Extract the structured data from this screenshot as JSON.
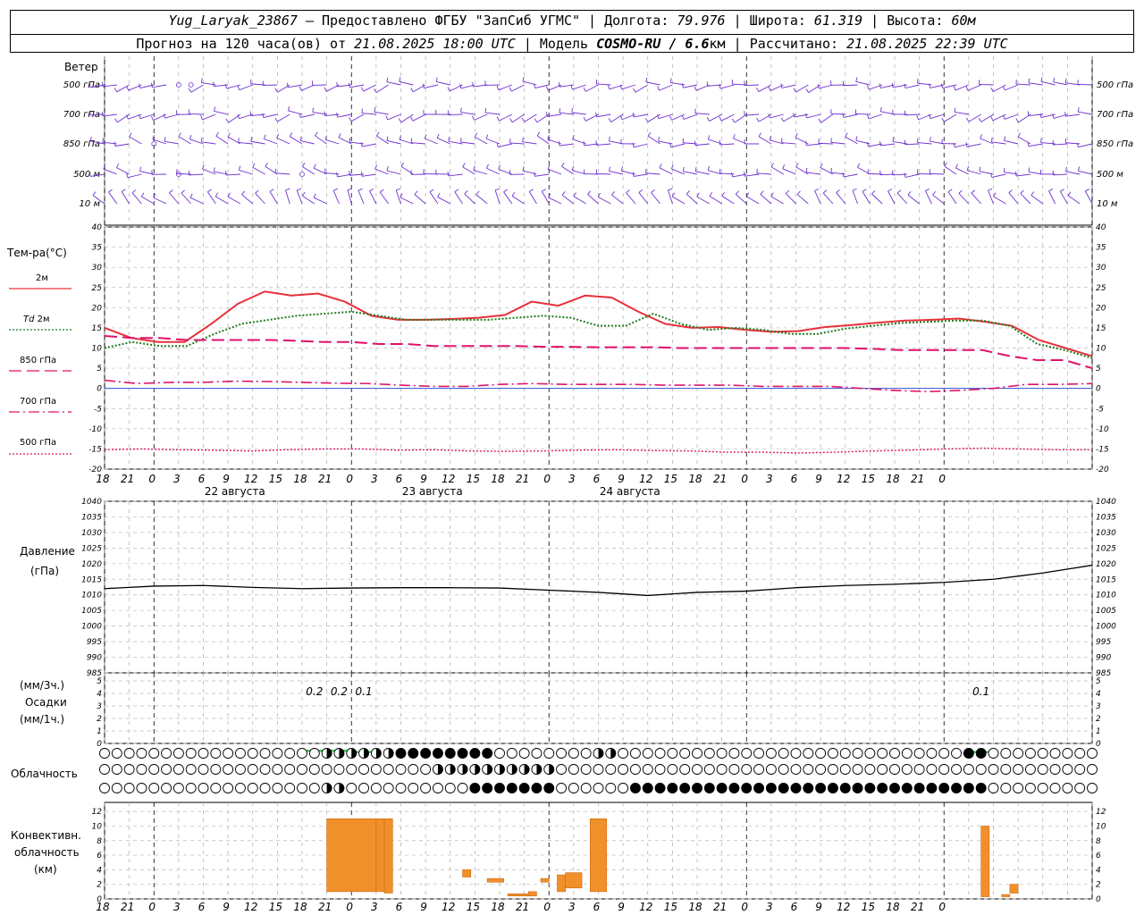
{
  "header": {
    "station": "Yug_Laryak_23867",
    "provider": "Предоставлено ФГБУ \"ЗапСиб УГМС\"",
    "lon_label": "Долгота:",
    "lon": "79.976",
    "lat_label": "Широта:",
    "lat": "61.319",
    "alt_label": "Высота:",
    "alt": "60м",
    "forecast_label": "Прогноз на 120 часа(ов) от",
    "forecast_start": "21.08.2025 18:00 UTC",
    "model_label": "Модель",
    "model": "COSMO-RU / 6.6",
    "model_unit": "км",
    "calc_label": "Рассчитано:",
    "calc_time": "21.08.2025 22:39 UTC"
  },
  "wind": {
    "title": "Ветер",
    "levels": [
      "500 гПа",
      "700 гПа",
      "850 гПа",
      "500 м",
      "10 м"
    ]
  },
  "temperature": {
    "title": "Тем-ра(°С)",
    "legend": [
      {
        "label": "2м",
        "color": "#e8303a",
        "style": "solid"
      },
      {
        "label": "Td 2м",
        "color": "#1f7a1f",
        "style": "dotted"
      },
      {
        "label": "850 гПа",
        "color": "#e0106a",
        "style": "dashed"
      },
      {
        "label": "700 гПа",
        "color": "#e0106a",
        "style": "dashdot"
      },
      {
        "label": "500 гПа",
        "color": "#e0106a",
        "style": "dotted"
      }
    ]
  },
  "time_axis": {
    "hours": [
      "18",
      "21",
      "0",
      "3",
      "6",
      "9",
      "12",
      "15",
      "18",
      "21",
      "0",
      "3",
      "6",
      "9",
      "12",
      "15",
      "18",
      "21",
      "0",
      "3",
      "6",
      "9",
      "12",
      "15",
      "18",
      "21",
      "0",
      "3",
      "6",
      "9",
      "12",
      "15",
      "18",
      "21",
      "0"
    ],
    "days": [
      "22 августа",
      "23 августа",
      "24 августа"
    ]
  },
  "pressure": {
    "title_line1": "Давление",
    "title_line2": "(гПа)"
  },
  "precip": {
    "line1": "(мм/3ч.)",
    "line2": "Осадки",
    "line3": "(мм/1ч.)",
    "labels": [
      "0.2",
      "0.2",
      "0.1",
      "0.1"
    ]
  },
  "clouds": {
    "title": "Облачность"
  },
  "convective": {
    "line1": "Конвективн.",
    "line2": "облачность",
    "line3": "(км)"
  },
  "chart_data": [
    {
      "type": "line",
      "title": "Тем-ра(°С)",
      "x_hours": [
        0,
        3,
        6,
        9,
        12,
        15,
        18,
        21,
        24,
        27,
        30,
        33,
        36,
        39,
        42,
        45,
        48,
        51,
        54,
        57,
        60,
        63,
        66,
        69,
        72,
        75,
        78,
        81,
        84,
        87,
        90,
        93,
        96,
        99,
        102,
        105,
        108,
        111,
        114,
        117,
        120
      ],
      "ylim": [
        -20,
        40
      ],
      "series": [
        {
          "name": "2м",
          "values": [
            15,
            12.5,
            11.5,
            11.5,
            16,
            21,
            24,
            23,
            23.5,
            21.5,
            18,
            17,
            17,
            17.2,
            17.5,
            18.2,
            21.5,
            20.5,
            23,
            22.5,
            19,
            16,
            15,
            15.2,
            14.5,
            14,
            14.2,
            15.2,
            15.7,
            16.3,
            16.8,
            17,
            17.3,
            16.5,
            15.5,
            12,
            10,
            8
          ]
        },
        {
          "name": "Td 2м",
          "values": [
            10,
            11.5,
            10.5,
            10.5,
            13.5,
            16,
            17,
            18,
            18.5,
            19,
            18,
            17,
            17,
            17,
            17,
            17.5,
            18,
            17.5,
            15.5,
            15.5,
            18.5,
            16,
            14.5,
            15,
            14.5,
            13.5,
            13.5,
            14.8,
            15.5,
            16.2,
            16.5,
            16.8,
            16.8,
            15.5,
            11,
            9.5,
            7.5
          ]
        },
        {
          "name": "850 гПа",
          "values": [
            13,
            12.5,
            12.5,
            12,
            12,
            12,
            12,
            11.8,
            11.5,
            11.5,
            11,
            11,
            10.5,
            10.5,
            10.5,
            10.5,
            10.3,
            10.3,
            10.2,
            10.2,
            10.2,
            10,
            10,
            10,
            10,
            10,
            10,
            10,
            9.8,
            9.5,
            9.5,
            9.5,
            9.5,
            8,
            7,
            7,
            5
          ]
        },
        {
          "name": "700 гПа",
          "values": [
            2,
            1.2,
            1.5,
            1.5,
            1.8,
            1.7,
            1.5,
            1.3,
            1.2,
            0.8,
            0.5,
            0.5,
            1,
            1.2,
            1,
            1,
            1,
            0.8,
            0.8,
            0.8,
            0.5,
            0.5,
            0.5,
            0,
            -0.5,
            -0.8,
            -0.5,
            0,
            1,
            1,
            1.2
          ]
        },
        {
          "name": "500 гПа",
          "values": [
            -15.2,
            -15,
            -15.2,
            -15.3,
            -15.5,
            -15.2,
            -15,
            -15,
            -15.3,
            -15.2,
            -15.5,
            -15.6,
            -15.5,
            -15.3,
            -15.2,
            -15.4,
            -15.5,
            -15.8,
            -15.8,
            -16,
            -15.8,
            -15.5,
            -15.3,
            -15,
            -14.8,
            -15,
            -15.2,
            -15.2
          ]
        }
      ]
    },
    {
      "type": "line",
      "title": "Давление (гПа)",
      "x_hours": [
        0,
        6,
        12,
        18,
        24,
        30,
        36,
        42,
        48,
        54,
        60,
        66,
        72,
        78,
        84,
        90,
        96,
        102,
        108,
        114,
        120
      ],
      "ylim": [
        985,
        1040
      ],
      "series": [
        {
          "name": "",
          "values": [
            1012,
            1012.8,
            1013,
            1012.4,
            1012,
            1012.2,
            1012.3,
            1012.3,
            1012.2,
            1011.5,
            1010.8,
            1009.8,
            1010.8,
            1011.2,
            1012.3,
            1013,
            1013.4,
            1014,
            1015,
            1017,
            1019.5
          ]
        }
      ]
    },
    {
      "type": "bar",
      "title": "Осадки (мм/3ч.)",
      "x_hours": [
        27,
        30,
        33,
        108
      ],
      "ylim": [
        0,
        5
      ],
      "values": [
        0.2,
        0.2,
        0.1,
        0.1
      ],
      "labels": [
        "0.2",
        "0.2",
        "0.1",
        "0.1"
      ]
    },
    {
      "type": "bar",
      "title": "Конвективн. облачность (км)",
      "ylim": [
        0,
        13
      ],
      "bars": [
        {
          "from_hour": 27,
          "to_hour": 33,
          "bottom": 1,
          "top": 11
        },
        {
          "from_hour": 33,
          "to_hour": 34,
          "bottom": 1,
          "top": 11
        },
        {
          "from_hour": 34,
          "to_hour": 35,
          "bottom": 0.8,
          "top": 11
        },
        {
          "from_hour": 43.5,
          "to_hour": 44.5,
          "bottom": 3,
          "top": 4
        },
        {
          "from_hour": 46.5,
          "to_hour": 48.5,
          "bottom": 2.3,
          "top": 2.8
        },
        {
          "from_hour": 49,
          "to_hour": 51.5,
          "bottom": 0.4,
          "top": 0.7
        },
        {
          "from_hour": 51.5,
          "to_hour": 52.5,
          "bottom": 0.4,
          "top": 1
        },
        {
          "from_hour": 53,
          "to_hour": 54,
          "bottom": 2.3,
          "top": 2.8
        },
        {
          "from_hour": 55,
          "to_hour": 56,
          "bottom": 1,
          "top": 3.3
        },
        {
          "from_hour": 56,
          "to_hour": 58,
          "bottom": 1.5,
          "top": 3.6
        },
        {
          "from_hour": 59,
          "to_hour": 61,
          "bottom": 1,
          "top": 11
        },
        {
          "from_hour": 106.5,
          "to_hour": 107.5,
          "bottom": 0.3,
          "top": 10
        },
        {
          "from_hour": 109,
          "to_hour": 110,
          "bottom": 0.3,
          "top": 0.6
        },
        {
          "from_hour": 110,
          "to_hour": 111,
          "bottom": 0.8,
          "top": 2
        }
      ]
    }
  ]
}
